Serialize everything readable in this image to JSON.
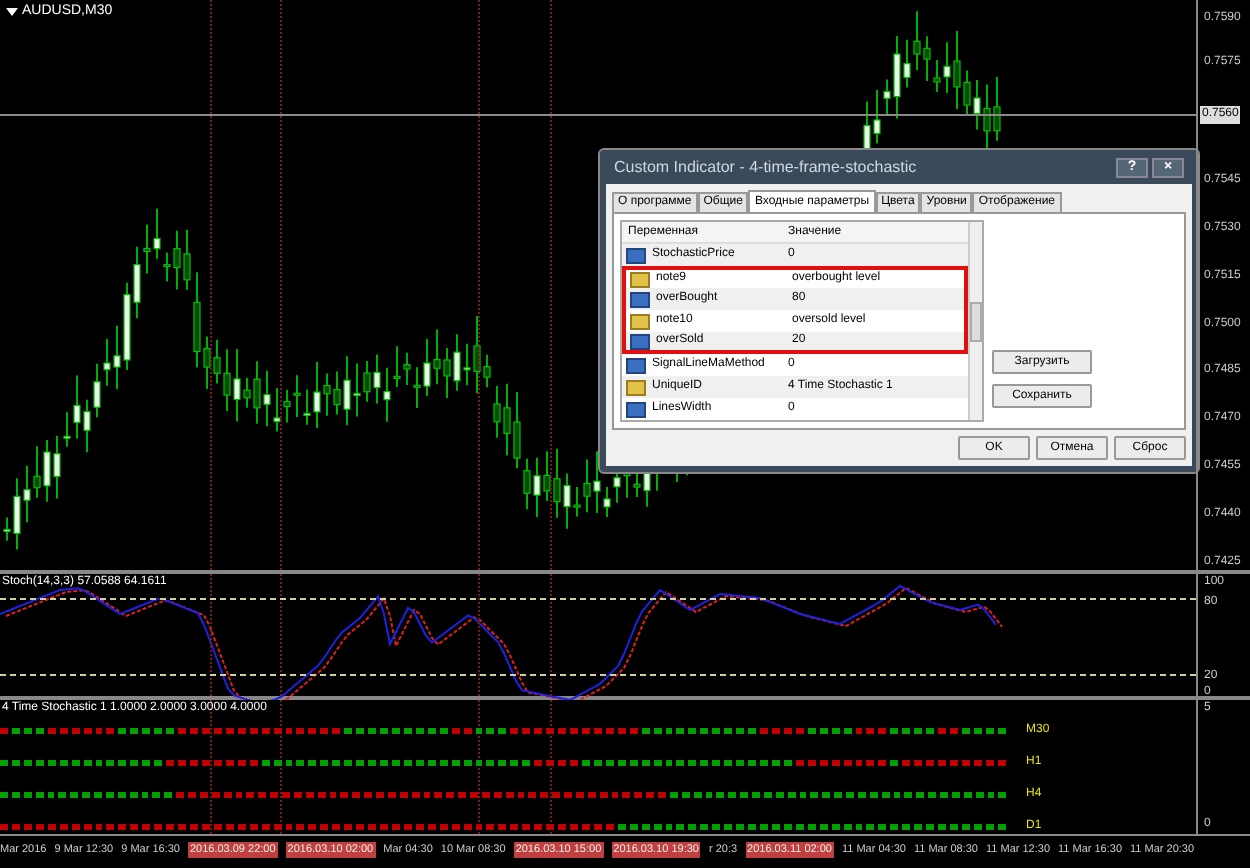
{
  "chart": {
    "symbol": "AUDUSD,M30",
    "price_axis": [
      "0.7590",
      "0.7575",
      "0.7545",
      "0.7530",
      "0.7515",
      "0.7500",
      "0.7485",
      "0.7470",
      "0.7455",
      "0.7440",
      "0.7425"
    ],
    "current_price": "0.7560"
  },
  "stochastic": {
    "label": "Stoch(14,3,3) 57.0588 64.1611",
    "axis": [
      "100",
      "80",
      "20",
      "0"
    ]
  },
  "four_tf": {
    "label": "4 Time Stochastic 1 1.0000 2.0000 3.0000 4.0000",
    "axis": [
      "5",
      "0"
    ],
    "rows": [
      {
        "label": "M30"
      },
      {
        "label": "H1"
      },
      {
        "label": "H4"
      },
      {
        "label": "D1"
      }
    ]
  },
  "time_axis": [
    {
      "label": "Mar 2016",
      "highlighted": false
    },
    {
      "label": "9 Mar 12:30",
      "highlighted": false
    },
    {
      "label": "9 Mar 16:30",
      "highlighted": false
    },
    {
      "label": "2016.03.09 22:00",
      "highlighted": true
    },
    {
      "label": "2016.03.10 02:00",
      "highlighted": true
    },
    {
      "label": "Mar 04:30",
      "highlighted": false
    },
    {
      "label": "10 Mar 08:30",
      "highlighted": false
    },
    {
      "label": "2016.03.10 15:00",
      "highlighted": true
    },
    {
      "label": "2016.03.10 19:30",
      "highlighted": true
    },
    {
      "label": "r 20:3",
      "highlighted": false
    },
    {
      "label": "2016.03.11 02:00",
      "highlighted": true
    },
    {
      "label": "11 Mar 04:30",
      "highlighted": false
    },
    {
      "label": "11 Mar 08:30",
      "highlighted": false
    },
    {
      "label": "11 Mar 12:30",
      "highlighted": false
    },
    {
      "label": "11 Mar 16:30",
      "highlighted": false
    },
    {
      "label": "11 Mar 20:30",
      "highlighted": false
    }
  ],
  "dialog": {
    "title": "Custom Indicator - 4-time-frame-stochastic",
    "title_buttons": [
      "?",
      "×"
    ],
    "tabs": [
      {
        "label": "О программе",
        "selected": false
      },
      {
        "label": "Общие",
        "selected": false
      },
      {
        "label": "Входные параметры",
        "selected": true
      },
      {
        "label": "Цвета",
        "selected": false
      },
      {
        "label": "Уровни",
        "selected": false
      },
      {
        "label": "Отображение",
        "selected": false
      }
    ],
    "columns": [
      "Переменная",
      "Значение"
    ],
    "rows": [
      {
        "kind": "number",
        "name": "StochasticPrice",
        "value": "0",
        "highlighted": false
      },
      {
        "kind": "text",
        "name": "note9",
        "value": "overbought level",
        "highlighted": true
      },
      {
        "kind": "number",
        "name": "overBought",
        "value": "80",
        "highlighted": true
      },
      {
        "kind": "text",
        "name": "note10",
        "value": "oversold level",
        "highlighted": true
      },
      {
        "kind": "number",
        "name": "overSold",
        "value": "20",
        "highlighted": true
      },
      {
        "kind": "number",
        "name": "SignalLineMaMethod",
        "value": "0",
        "highlighted": false
      },
      {
        "kind": "text",
        "name": "UniqueID",
        "value": "4 Time Stochastic 1",
        "highlighted": false
      },
      {
        "kind": "number",
        "name": "LinesWidth",
        "value": "0",
        "highlighted": false
      }
    ],
    "side_buttons": [
      "Загрузить",
      "Сохранить"
    ],
    "buttons": [
      "OK",
      "Отмена",
      "Сброс"
    ]
  }
}
